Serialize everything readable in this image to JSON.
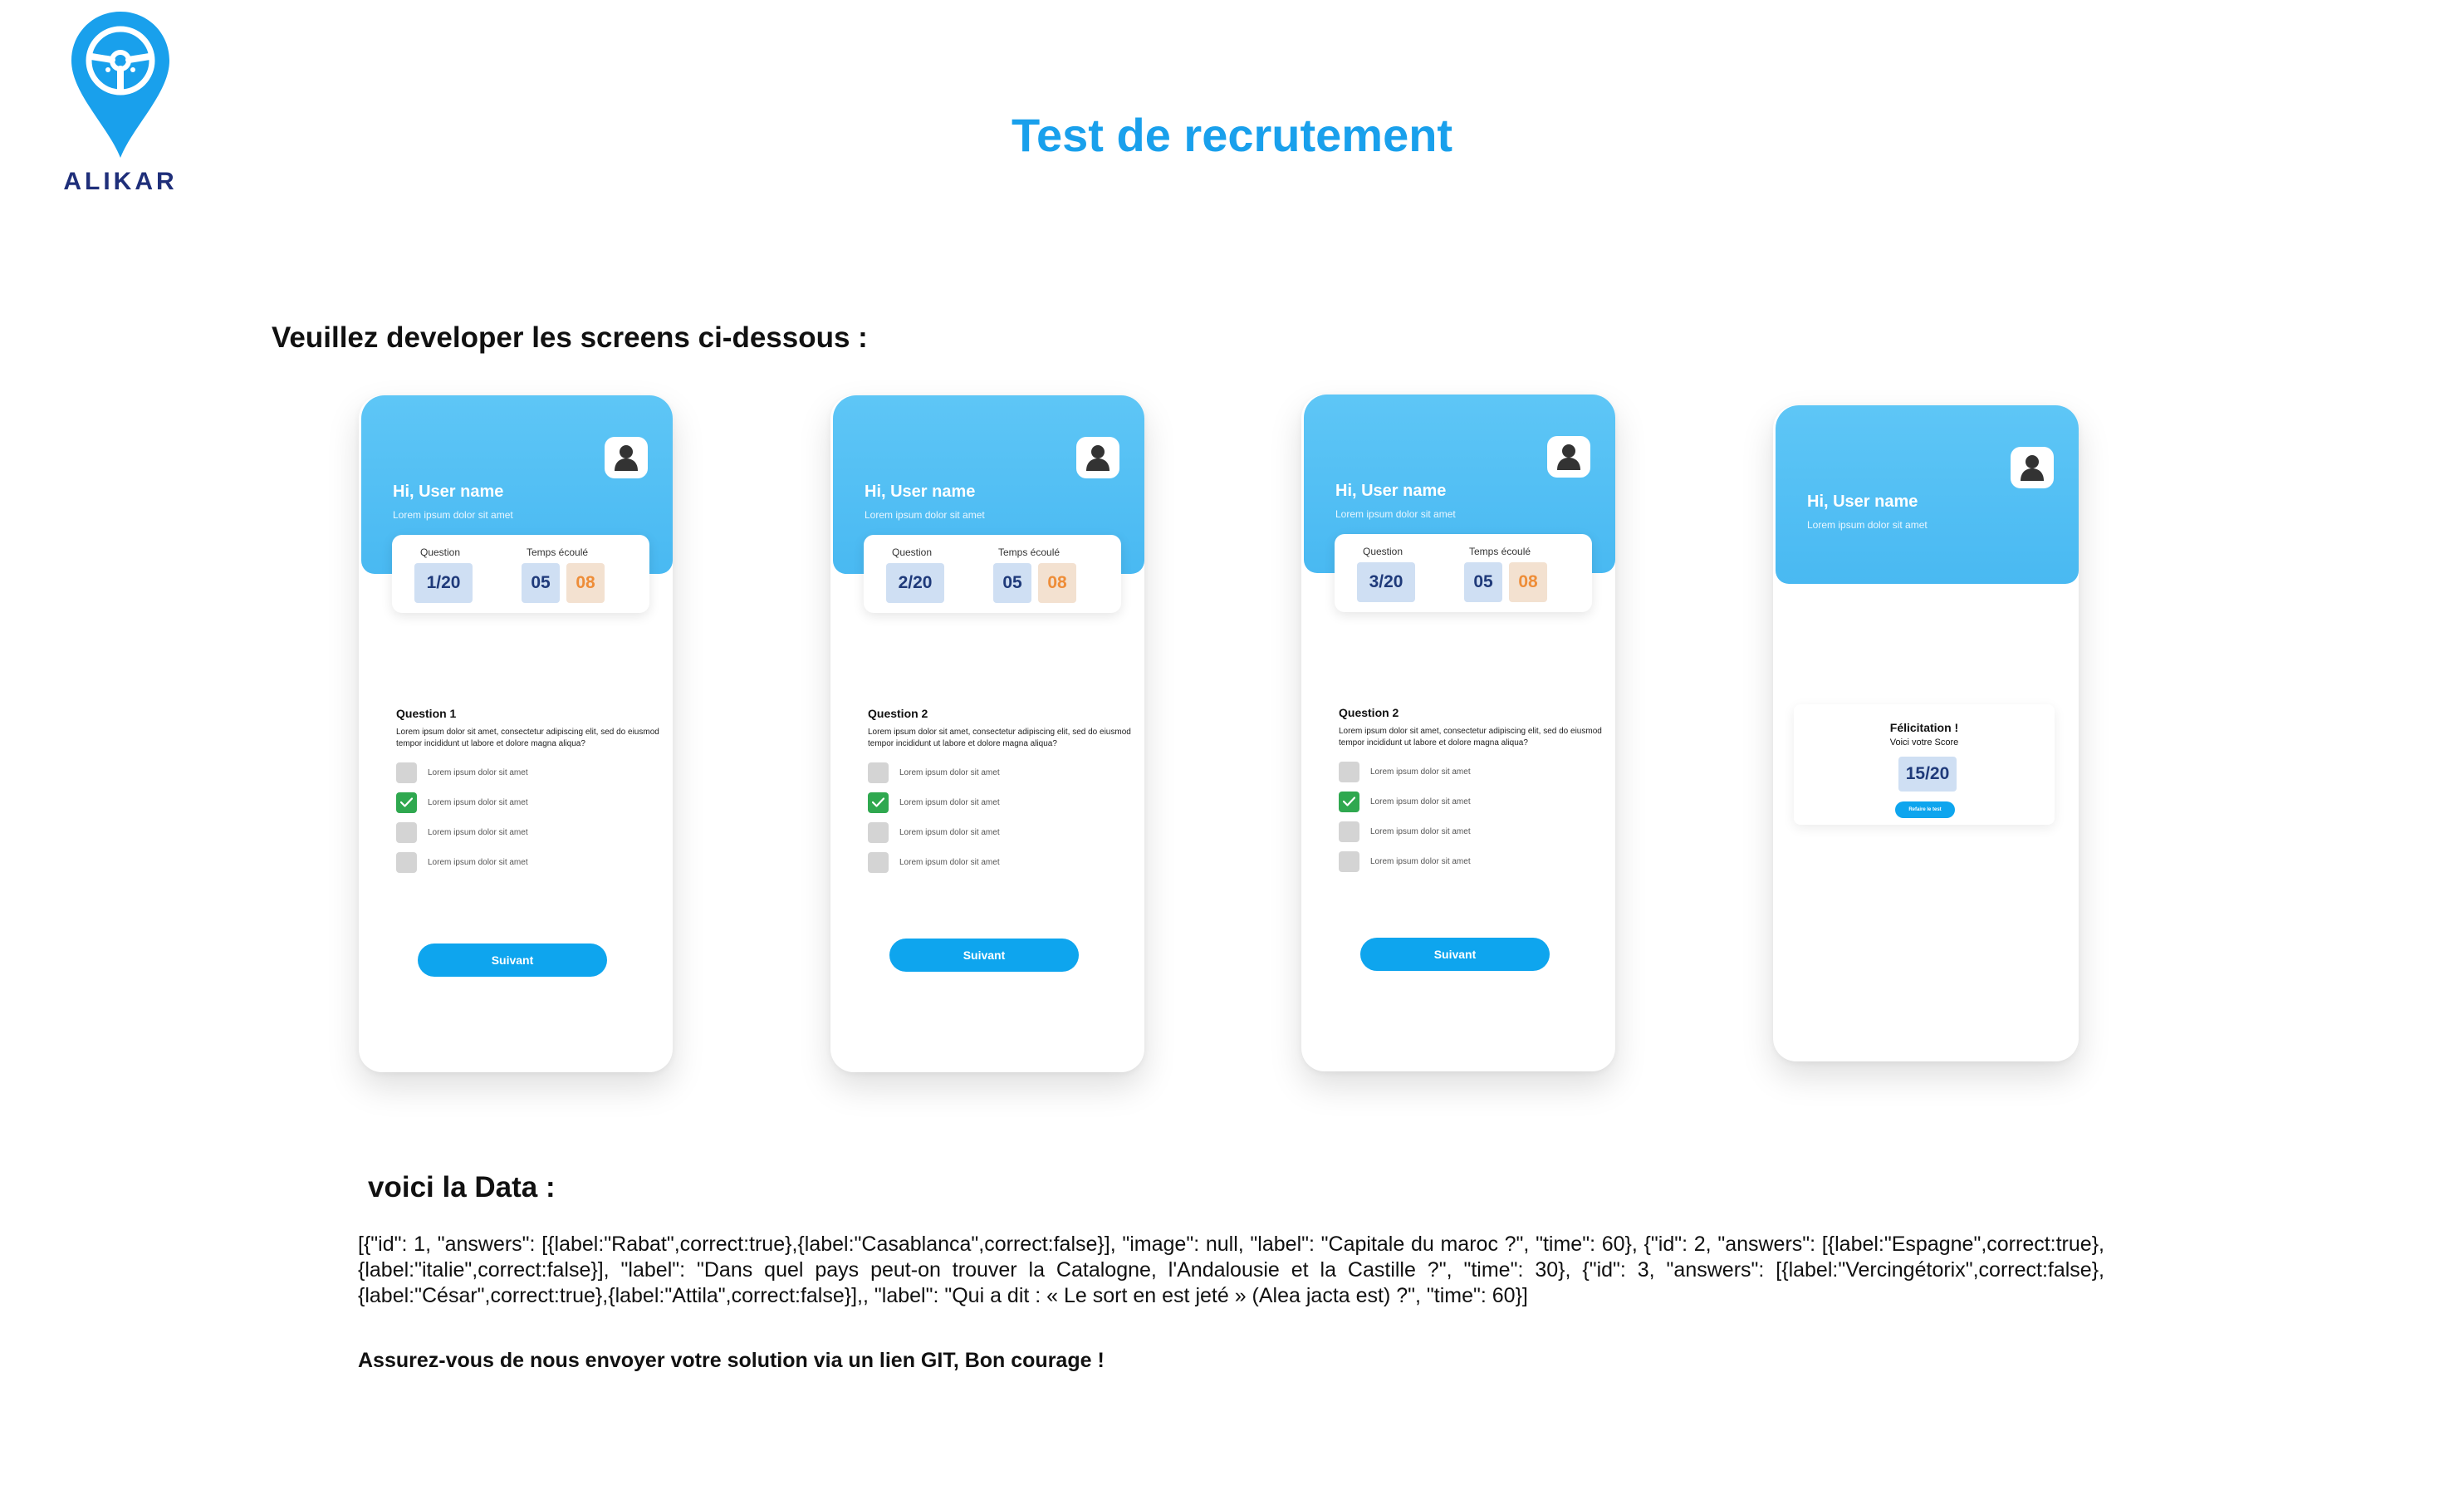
{
  "brand": {
    "name": "ALIKAR",
    "color": "#1f2f7a",
    "pin_color": "#19a0ec"
  },
  "title": "Test de recrutement",
  "instruction": "Veuillez developer les screens ci-dessous :",
  "colors": {
    "accent": "#19a0ec",
    "header": "#5ec6f6",
    "button": "#0ea5ee",
    "checked": "#2fa84f",
    "time_seconds": "#ee8d38"
  },
  "screens": [
    {
      "greeting": "Hi, User name",
      "subtitle": "Lorem ipsum dolor sit amet",
      "question_label": "Question",
      "time_label": "Temps écoulé",
      "question_count": "1/20",
      "minutes": "05",
      "seconds": "08",
      "question_title": "Question 1",
      "question_text": "Lorem ipsum dolor sit amet, consectetur adipiscing elit, sed do eiusmod tempor incididunt ut labore et dolore magna aliqua?",
      "options": [
        {
          "label": "Lorem ipsum dolor sit amet",
          "checked": false
        },
        {
          "label": "Lorem ipsum dolor sit amet",
          "checked": true
        },
        {
          "label": "Lorem ipsum dolor sit amet",
          "checked": false
        },
        {
          "label": "Lorem ipsum dolor sit amet",
          "checked": false
        }
      ],
      "next_label": "Suivant"
    },
    {
      "greeting": "Hi, User name",
      "subtitle": "Lorem ipsum dolor sit amet",
      "question_label": "Question",
      "time_label": "Temps écoulé",
      "question_count": "2/20",
      "minutes": "05",
      "seconds": "08",
      "question_title": "Question 2",
      "question_text": "Lorem ipsum dolor sit amet, consectetur adipiscing elit, sed do eiusmod tempor incididunt ut labore et dolore magna aliqua?",
      "options": [
        {
          "label": "Lorem ipsum dolor sit amet",
          "checked": false
        },
        {
          "label": "Lorem ipsum dolor sit amet",
          "checked": true
        },
        {
          "label": "Lorem ipsum dolor sit amet",
          "checked": false
        },
        {
          "label": "Lorem ipsum dolor sit amet",
          "checked": false
        }
      ],
      "next_label": "Suivant"
    },
    {
      "greeting": "Hi, User name",
      "subtitle": "Lorem ipsum dolor sit amet",
      "question_label": "Question",
      "time_label": "Temps écoulé",
      "question_count": "3/20",
      "minutes": "05",
      "seconds": "08",
      "question_title": "Question 2",
      "question_text": "Lorem ipsum dolor sit amet, consectetur adipiscing elit, sed do eiusmod tempor incididunt ut labore et dolore magna aliqua?",
      "options": [
        {
          "label": "Lorem ipsum dolor sit amet",
          "checked": false
        },
        {
          "label": "Lorem ipsum dolor sit amet",
          "checked": true
        },
        {
          "label": "Lorem ipsum dolor sit amet",
          "checked": false
        },
        {
          "label": "Lorem ipsum dolor sit amet",
          "checked": false
        }
      ],
      "next_label": "Suivant"
    }
  ],
  "result_screen": {
    "greeting": "Hi, User name",
    "subtitle": "Lorem ipsum dolor sit amet",
    "title": "Félicitation !",
    "subtitle2": "Voici votre Score",
    "score": "15/20",
    "retry_label": "Refaire le test"
  },
  "data_section": {
    "title": "voici la Data :",
    "text": "[{\"id\": 1, \"answers\": [{label:\"Rabat\",correct:true},{label:\"Casablanca\",correct:false}], \"image\": null, \"label\": \"Capitale du maroc ?\", \"time\": 60}, {\"id\": 2, \"answers\": [{label:\"Espagne\",correct:true},{label:\"italie\",correct:false}],  \"label\": \"Dans quel pays peut-on trouver la Catalogne, l'Andalousie et la Castille ?\", \"time\": 30}, {\"id\": 3, \"answers\": [{label:\"Vercingétorix\",correct:false},{label:\"César\",correct:true},{label:\"Attila\",correct:false}],, \"label\": \"Qui a dit : « Le sort en est jeté » (Alea jacta est) ?\", \"time\": 60}]"
  },
  "footer_note": "Assurez-vous de nous envoyer votre solution via un lien GIT, Bon courage !"
}
